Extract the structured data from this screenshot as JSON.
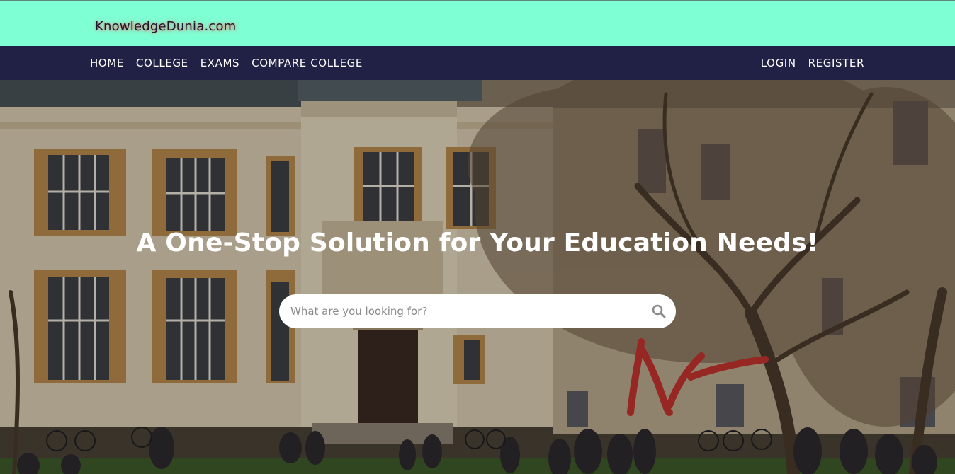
{
  "brand": {
    "logo_text": "KnowledgeDunia.com",
    "topbar_color": "#7fffd4",
    "navbar_color": "#212145"
  },
  "nav": {
    "left": [
      {
        "label": "HOME"
      },
      {
        "label": "COLLEGE"
      },
      {
        "label": "EXAMS"
      },
      {
        "label": "COMPARE COLLEGE"
      }
    ],
    "right": [
      {
        "label": "LOGIN"
      },
      {
        "label": "REGISTER"
      }
    ]
  },
  "hero": {
    "headline": "A One-Stop Solution for Your Education Needs!",
    "search": {
      "placeholder": "What are you looking for?",
      "value": "",
      "icon": "search-icon"
    }
  }
}
